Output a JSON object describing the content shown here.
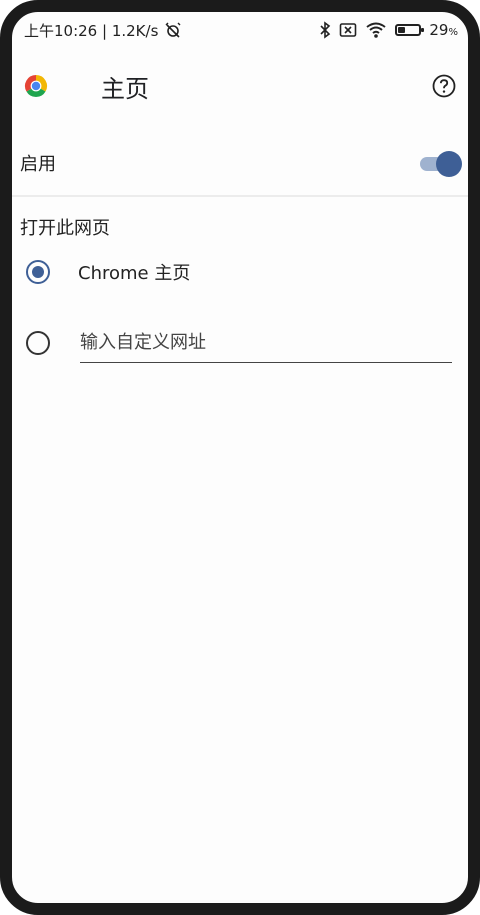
{
  "status_bar": {
    "time_speed": "上午10:26 | 1.2K/s",
    "battery_text": "29",
    "battery_percent_symbol": "%",
    "battery_level": 0.29
  },
  "app_bar": {
    "title": "主页",
    "logo_icon": "chrome-logo-icon",
    "help_icon": "help-circle-icon"
  },
  "enable_setting": {
    "label": "启用",
    "enabled": true
  },
  "open_page": {
    "section_title": "打开此网页",
    "options": [
      {
        "label": "Chrome 主页",
        "selected": true
      },
      {
        "placeholder": "输入自定义网址",
        "selected": false
      }
    ]
  },
  "colors": {
    "accent": "#3e5f96",
    "toggle_track": "#9fb2cf"
  }
}
